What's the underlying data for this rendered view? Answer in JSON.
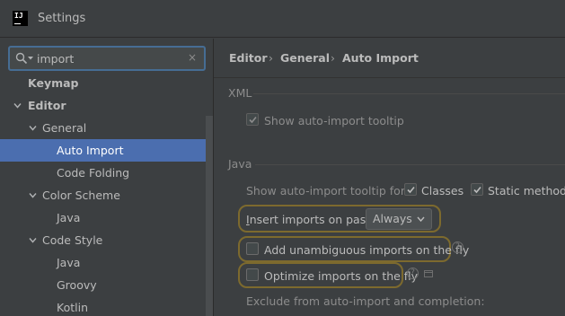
{
  "window": {
    "title": "Settings",
    "logo_text": "IJ"
  },
  "search": {
    "value": "import",
    "clear_glyph": "×"
  },
  "tree": [
    {
      "label": "Keymap",
      "bold": true
    },
    {
      "label": "Editor",
      "bold": true
    },
    {
      "label": "General"
    },
    {
      "label": "Auto Import",
      "selected": true
    },
    {
      "label": "Code Folding"
    },
    {
      "label": "Color Scheme"
    },
    {
      "label": "Java"
    },
    {
      "label": "Code Style"
    },
    {
      "label": "Java"
    },
    {
      "label": "Groovy"
    },
    {
      "label": "Kotlin"
    }
  ],
  "breadcrumb": {
    "items": [
      "Editor",
      "General",
      "Auto Import"
    ],
    "sep": "›"
  },
  "xml": {
    "title": "XML",
    "show_tooltip": {
      "label": "Show auto-import tooltip",
      "checked": true,
      "enabled": false
    }
  },
  "java": {
    "title": "Java",
    "tooltip_for_label": "Show auto-import tooltip for:",
    "classes": {
      "label": "Classes",
      "checked": true
    },
    "static_methods": {
      "label": "Static methods",
      "checked": true
    },
    "insert_on_paste": {
      "label": "Insert imports on paste:",
      "value": "Always"
    },
    "add_unambiguous": {
      "label": "Add unambiguous imports on the fly",
      "checked": false
    },
    "optimize_imports": {
      "label": "Optimize imports on the fly",
      "checked": false
    },
    "exclude_label": "Exclude from auto-import and completion:"
  },
  "icons": {
    "search": "search-icon",
    "arrow_down": "chevron-down-icon",
    "help": "help-icon",
    "project": "project-scope-icon"
  },
  "colors": {
    "background": "#3c3f41",
    "selection": "#4b6eaf",
    "focus_ring": "#466d94",
    "highlight": "#7d6a2e"
  }
}
